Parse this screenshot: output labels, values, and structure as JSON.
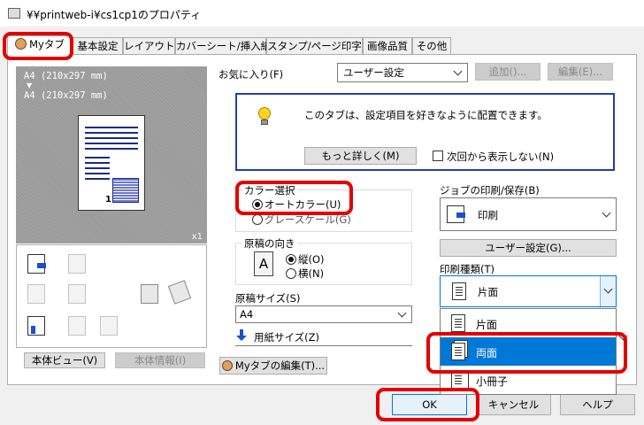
{
  "window": {
    "title": "¥¥printweb-i¥cs1cp1のプロパティ"
  },
  "tabs": [
    "Myタブ",
    "基本設定",
    "レイアウト",
    "カバーシート/挿入紙",
    "スタンプ/ページ印字",
    "画像品質",
    "その他"
  ],
  "preview": {
    "line1": "A4 (210x297 mm)",
    "arrow": "▼",
    "line2": "A4 (210x297 mm)",
    "scale": "x1",
    "page_num": "1"
  },
  "left_buttons": {
    "device_view": "本体ビュー(V)",
    "device_info": "本体情報(I)"
  },
  "favorites": {
    "label": "お気に入り(F)",
    "value": "ユーザー設定",
    "add": "追加()...",
    "edit": "編集(E)..."
  },
  "info": {
    "message": "このタブは、設定項目を好きなように配置できます。",
    "more": "もっと詳しく(M)",
    "dont_show": "次回から表示しない(N)"
  },
  "color": {
    "label": "カラー選択",
    "auto": "オートカラー(U)",
    "gray": "グレースケール(G)"
  },
  "orientation": {
    "label": "原稿の向き",
    "portrait": "縦(O)",
    "landscape": "横(N)",
    "letter": "A"
  },
  "orig_size": {
    "label": "原稿サイズ(S)",
    "value": "A4"
  },
  "paper_size": {
    "label": "用紙サイズ(Z)"
  },
  "job": {
    "label": "ジョブの印刷/保存(B)",
    "value": "印刷",
    "user_settings": "ユーザー設定(G)..."
  },
  "print_type": {
    "label": "印刷種類(T)",
    "value": "片面",
    "options": [
      "片面",
      "両面",
      "小冊子"
    ]
  },
  "mytab_edit": "Myタブの編集(T)...",
  "footer": {
    "ok": "OK",
    "cancel": "キャンセル",
    "help": "ヘルプ"
  }
}
